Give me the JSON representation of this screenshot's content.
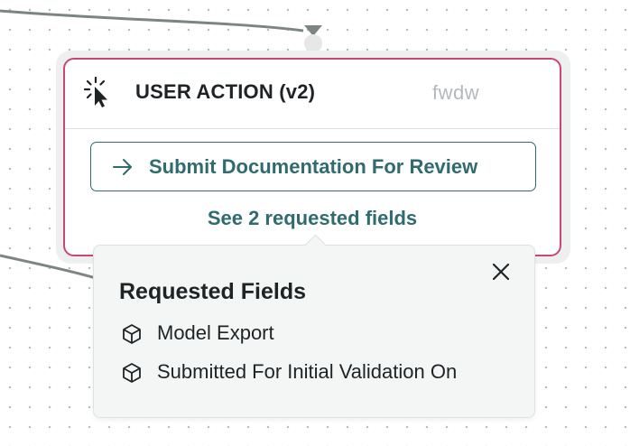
{
  "node": {
    "title": "USER ACTION (v2)",
    "id": "fwdw",
    "icon": "cursor-click-icon",
    "border_color": "#c94677",
    "action_button": {
      "label": "Submit Documentation For Review",
      "icon": "arrow-right-icon"
    },
    "fields_link": "See 2 requested fields"
  },
  "popover": {
    "title": "Requested Fields",
    "close_icon": "close-icon",
    "fields": [
      {
        "label": "Model Export",
        "icon": "cube-icon"
      },
      {
        "label": "Submitted For Initial Validation On",
        "icon": "cube-icon"
      }
    ]
  },
  "colors": {
    "accent": "#2f6b6f",
    "node_border": "#c94677",
    "edge": "#7d8584"
  }
}
